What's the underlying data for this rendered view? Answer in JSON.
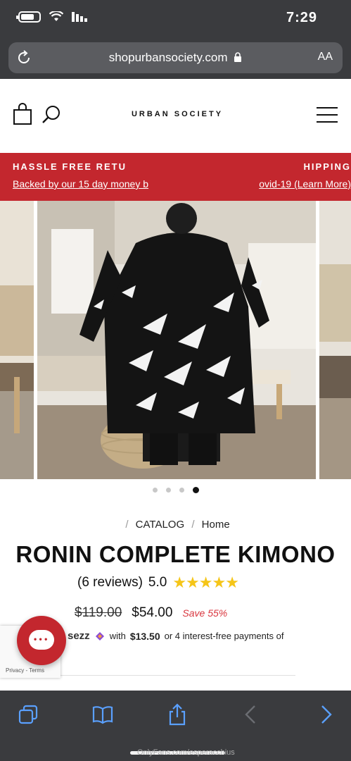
{
  "status_bar": {
    "time": "7:29"
  },
  "browser": {
    "url": "shopurbansociety.com",
    "text_size_label": "AA"
  },
  "header": {
    "logo": "URBAN SOCIETY"
  },
  "banner": {
    "left_line1": "HASSLE FREE RETU",
    "left_line2": "Backed by our 15 day money b",
    "right_line1": "HIPPING",
    "right_line2": "ovid-19 (Learn More)"
  },
  "breadcrumb": {
    "home": "Home",
    "separator": "/",
    "catalog": "CATALOG"
  },
  "product": {
    "title": "RONIN COMPLETE KIMONO",
    "rating": "5.0",
    "reviews": "(6 reviews)",
    "stars": "★★★★★",
    "price_original": "$119.00",
    "price_sale": "$54.00",
    "savings": "Save 55%"
  },
  "sezzle": {
    "prefix": "or 4 interest-free payments of",
    "amount": "$13.50",
    "with": "with",
    "brand": "sezz"
  },
  "carousel": {
    "slide_count": 4,
    "active_index": 3
  },
  "recaptcha": {
    "terms": "Privacy - Terms"
  },
  "watermark": "OnlyFans.com/esperacchius",
  "colors": {
    "brand_red": "#c3272e",
    "star": "#f5c518",
    "browser_accent": "#5aa0ff"
  }
}
